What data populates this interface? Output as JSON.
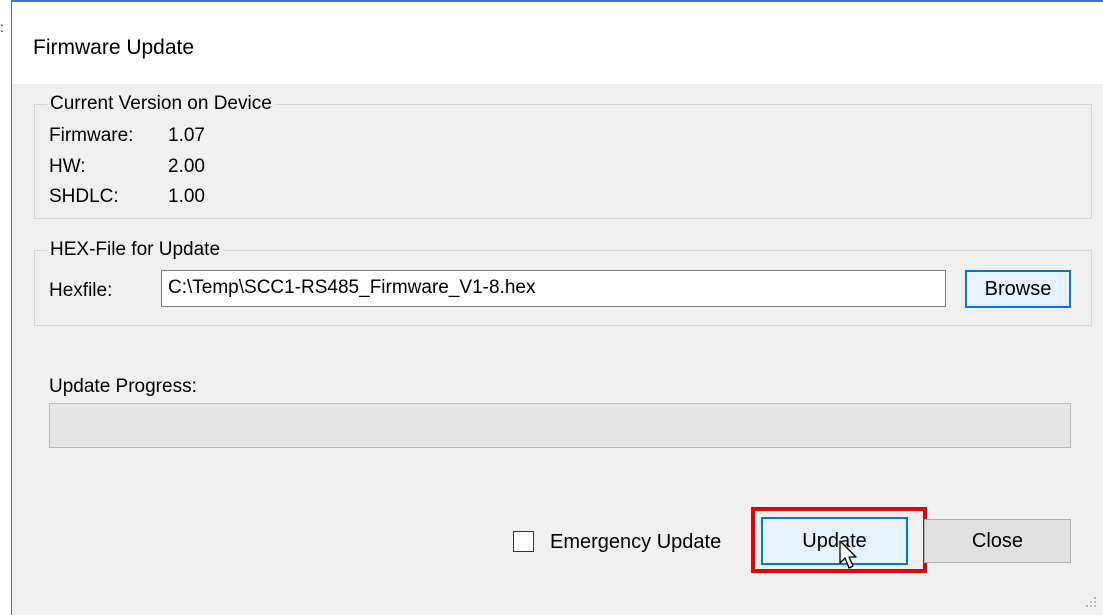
{
  "window": {
    "title": "Firmware Update"
  },
  "current_version": {
    "legend": "Current Version on Device",
    "rows": [
      {
        "label": "Firmware:",
        "value": "1.07"
      },
      {
        "label": "HW:",
        "value": "2.00"
      },
      {
        "label": "SHDLC:",
        "value": "1.00"
      }
    ]
  },
  "hex_file": {
    "legend": "HEX-File for Update",
    "label": "Hexfile:",
    "value": "C:\\Temp\\SCC1-RS485_Firmware_V1-8.hex",
    "browse_label": "Browse"
  },
  "progress": {
    "label": "Update Progress:",
    "value": 0
  },
  "footer": {
    "emergency_label": "Emergency Update",
    "emergency_checked": false,
    "update_label": "Update",
    "close_label": "Close"
  },
  "colors": {
    "accent": "#0078d7",
    "highlight": "#e60000",
    "title_border": "#3c7dd4"
  }
}
